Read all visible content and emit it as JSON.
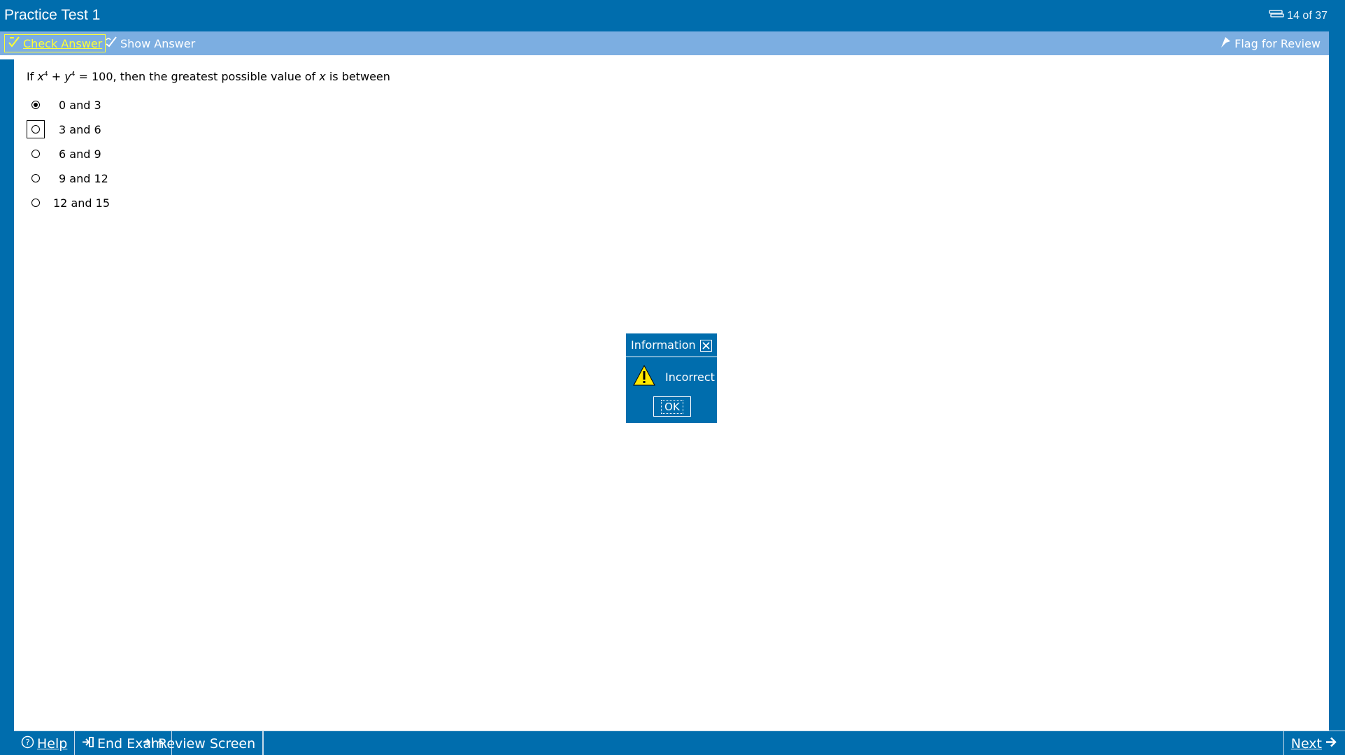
{
  "header": {
    "title": "Practice Test 1",
    "counter": "14 of 37"
  },
  "toolbar": {
    "check_answer": "Check Answer",
    "show_answer": "Show Answer",
    "flag_for_review": "Flag for Review",
    "check_answer_color": "#FFFF33"
  },
  "question": {
    "prefix": "If ",
    "var_x": "x",
    "exp1": "4",
    "plus": " + ",
    "var_y": "y",
    "exp2": "4",
    "middle": " = 100, then the greatest possible value of ",
    "var_x2": "x",
    "suffix": " is between"
  },
  "options": [
    {
      "label": "0 and 3",
      "selected": true
    },
    {
      "label": "3 and 6",
      "selected": false,
      "focused": true
    },
    {
      "label": "6 and 9",
      "selected": false
    },
    {
      "label": "9 and 12",
      "selected": false
    },
    {
      "label": "12 and 15",
      "selected": false
    }
  ],
  "dialog": {
    "title": "Information",
    "message": "Incorrect",
    "ok_label": "OK",
    "icon": "warning-icon"
  },
  "footer": {
    "help": "Help",
    "end_exam": "End Exam",
    "review_screen": "Review Screen",
    "next": "Next"
  },
  "colors": {
    "primary": "#006DAD",
    "toolbar": "#7CAEE1",
    "highlight": "#FFFF33"
  }
}
